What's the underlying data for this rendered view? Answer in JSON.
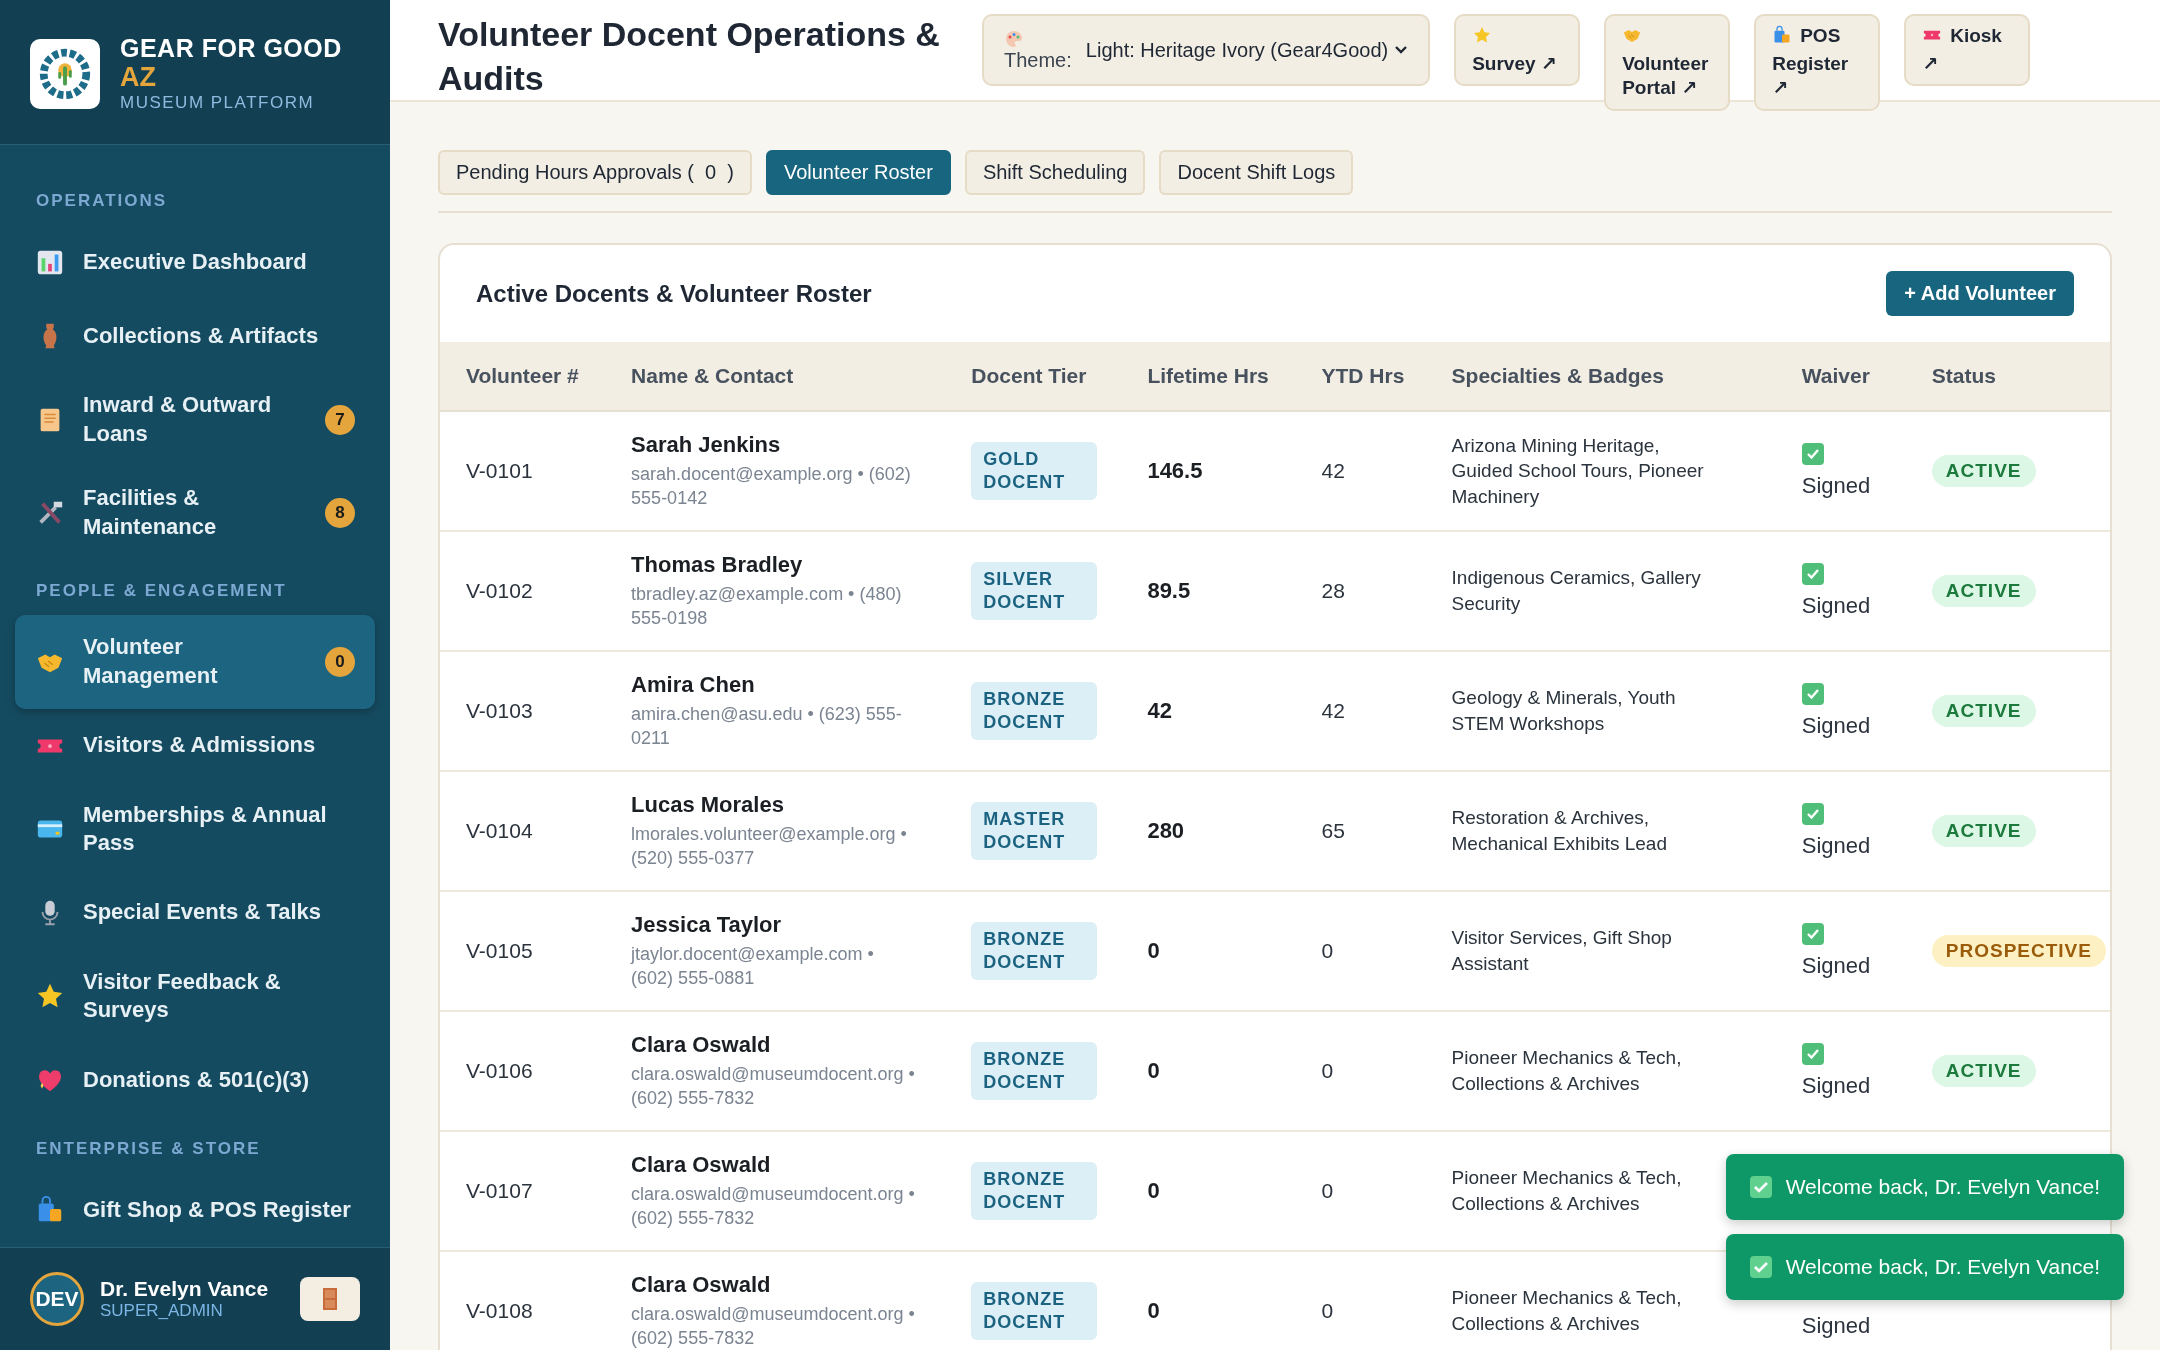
{
  "brand": {
    "name": "GEAR FOR GOOD",
    "accent": "AZ",
    "subtitle": "MUSEUM PLATFORM"
  },
  "sidebar": {
    "sections": [
      {
        "title": "OPERATIONS",
        "items": [
          {
            "label": "Executive Dashboard",
            "selected": false
          },
          {
            "label": "Collections & Artifacts",
            "selected": false
          },
          {
            "label": "Inward & Outward Loans",
            "badge": "7",
            "selected": false
          },
          {
            "label": "Facilities & Maintenance",
            "badge": "8",
            "selected": false
          }
        ]
      },
      {
        "title": "PEOPLE & ENGAGEMENT",
        "items": [
          {
            "label": "Volunteer Management",
            "badge": "0",
            "selected": true
          },
          {
            "label": "Visitors & Admissions",
            "selected": false
          },
          {
            "label": "Memberships & Annual Pass",
            "selected": false
          },
          {
            "label": "Special Events & Talks",
            "selected": false
          },
          {
            "label": "Visitor Feedback & Surveys",
            "selected": false
          },
          {
            "label": "Donations & 501(c)(3)",
            "selected": false
          }
        ]
      },
      {
        "title": "ENTERPRISE & STORE",
        "items": [
          {
            "label": "Gift Shop & POS Register",
            "selected": false
          }
        ]
      }
    ]
  },
  "user": {
    "initials": "DEV",
    "name": "Dr. Evelyn Vance",
    "role": "SUPER_ADMIN"
  },
  "header": {
    "title": "Volunteer Docent Operations & Audits",
    "theme": {
      "label": "Theme:",
      "value": "Light: Heritage Ivory (Gear4Good)"
    },
    "links": [
      "Survey ↗",
      "Volunteer Portal ↗",
      "POS Register ↗",
      "Kiosk ↗"
    ]
  },
  "tabs": [
    {
      "label": "Pending Hours Approvals (  0  )",
      "selected": false
    },
    {
      "label": "Volunteer Roster",
      "selected": true
    },
    {
      "label": "Shift Scheduling",
      "selected": false
    },
    {
      "label": "Docent Shift Logs",
      "selected": false
    }
  ],
  "roster": {
    "title": "Active Docents & Volunteer Roster",
    "add_button": "+ Add Volunteer",
    "columns": [
      "Volunteer #",
      "Name & Contact",
      "Docent Tier",
      "Lifetime Hrs",
      "YTD Hrs",
      "Specialties & Badges",
      "Waiver",
      "Status"
    ],
    "rows": [
      {
        "id": "V-0101",
        "name": "Sarah Jenkins",
        "contact": "sarah.docent@example.org • (602) 555-0142",
        "tier": "GOLD DOCENT",
        "lifetime": "146.5",
        "ytd": "42",
        "specialties": "Arizona Mining Heritage, Guided School Tours, Pioneer Machinery",
        "waiver": {
          "checked": true,
          "text": "Signed"
        },
        "status": {
          "text": "ACTIVE",
          "kind": "active"
        }
      },
      {
        "id": "V-0102",
        "name": "Thomas Bradley",
        "contact": "tbradley.az@example.com • (480) 555-0198",
        "tier": "SILVER DOCENT",
        "lifetime": "89.5",
        "ytd": "28",
        "specialties": "Indigenous Ceramics, Gallery Security",
        "waiver": {
          "checked": true,
          "text": "Signed"
        },
        "status": {
          "text": "ACTIVE",
          "kind": "active"
        }
      },
      {
        "id": "V-0103",
        "name": "Amira Chen",
        "contact": "amira.chen@asu.edu • (623) 555-0211",
        "tier": "BRONZE DOCENT",
        "lifetime": "42",
        "ytd": "42",
        "specialties": "Geology & Minerals, Youth STEM Workshops",
        "waiver": {
          "checked": true,
          "text": "Signed"
        },
        "status": {
          "text": "ACTIVE",
          "kind": "active"
        }
      },
      {
        "id": "V-0104",
        "name": "Lucas Morales",
        "contact": "lmorales.volunteer@example.org • (520) 555-0377",
        "tier": "MASTER DOCENT",
        "lifetime": "280",
        "ytd": "65",
        "specialties": "Restoration & Archives, Mechanical Exhibits Lead",
        "waiver": {
          "checked": true,
          "text": "Signed"
        },
        "status": {
          "text": "ACTIVE",
          "kind": "active"
        }
      },
      {
        "id": "V-0105",
        "name": "Jessica Taylor",
        "contact": "jtaylor.docent@example.com • (602) 555-0881",
        "tier": "BRONZE DOCENT",
        "lifetime": "0",
        "ytd": "0",
        "specialties": "Visitor Services, Gift Shop Assistant",
        "waiver": {
          "checked": true,
          "text": "Signed"
        },
        "status": {
          "text": "PROSPECTIVE",
          "kind": "prospective"
        }
      },
      {
        "id": "V-0106",
        "name": "Clara Oswald",
        "contact": "clara.oswald@museumdocent.org • (602) 555-7832",
        "tier": "BRONZE DOCENT",
        "lifetime": "0",
        "ytd": "0",
        "specialties": "Pioneer Mechanics & Tech, Collections & Archives",
        "waiver": {
          "checked": true,
          "text": "Signed"
        },
        "status": {
          "text": "ACTIVE",
          "kind": "active"
        }
      },
      {
        "id": "V-0107",
        "name": "Clara Oswald",
        "contact": "clara.oswald@museumdocent.org • (602) 555-7832",
        "tier": "BRONZE DOCENT",
        "lifetime": "0",
        "ytd": "0",
        "specialties": "Pioneer Mechanics & Tech, Collections & Archives"
      },
      {
        "id": "V-0108",
        "name": "Clara Oswald",
        "contact": "clara.oswald@museumdocent.org • (602) 555-7832",
        "tier": "BRONZE DOCENT",
        "lifetime": "0",
        "ytd": "0",
        "specialties": "Pioneer Mechanics & Tech, Collections & Archives",
        "waiver": {
          "text": "Signed"
        }
      }
    ]
  },
  "toasts": [
    "Welcome back, Dr. Evelyn Vance!",
    "Welcome back, Dr. Evelyn Vance!"
  ]
}
